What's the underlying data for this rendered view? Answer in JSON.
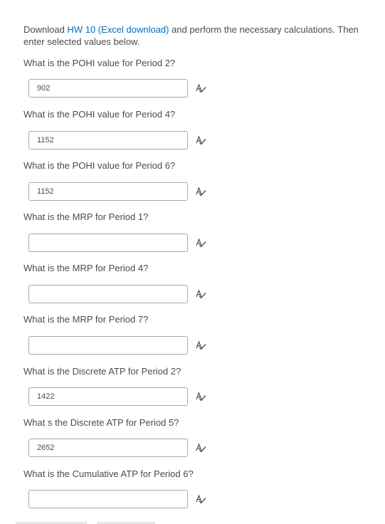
{
  "intro": {
    "before_link": "Download ",
    "link_text": "HW 10 (Excel download)",
    "after_link": " and perform the necessary calculations.  Then enter selected values below."
  },
  "questions": [
    {
      "label": "What is the POHI value for Period 2?",
      "value": "902",
      "placeholder": ""
    },
    {
      "label": "What is the POHI value for Period 4?",
      "value": "1152",
      "placeholder": ""
    },
    {
      "label": "What is the POHI value for Period 6?",
      "value": "1152",
      "placeholder": ""
    },
    {
      "label": "What is the MRP for Period 1?",
      "value": "",
      "placeholder": ""
    },
    {
      "label": "What is the MRP for Period 4?",
      "value": "",
      "placeholder": ""
    },
    {
      "label": "What is the MRP for Period 7?",
      "value": "",
      "placeholder": ""
    },
    {
      "label": "What is the Discrete ATP for Period 2?",
      "value": "1422",
      "placeholder": ""
    },
    {
      "label": "What s the Discrete ATP for Period 5?",
      "value": "2652",
      "placeholder": ""
    },
    {
      "label": "What is the Cumulative  ATP for Period 6?",
      "value": "",
      "placeholder": ""
    }
  ],
  "icons": {
    "spellcheck": "spellcheck-icon"
  },
  "colors": {
    "text": "#494c4e",
    "link": "#006fbf",
    "border": "#a6a9ab"
  }
}
